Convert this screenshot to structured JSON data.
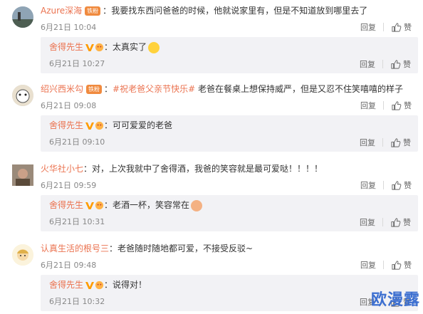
{
  "comments": [
    {
      "username": "Azure深海",
      "badge": "铁粉",
      "text": "我要找东西问爸爸的时候，他就说家里有，但是不知道放到哪里去了",
      "time": "6月21日 10:04",
      "reply_label": "回复",
      "like_label": "赞",
      "reply": {
        "username": "舍得先生",
        "text": "太真实了",
        "time": "6月21日 10:27",
        "reply_label": "回复",
        "like_label": "赞",
        "emoji": "laughing-tears-emoji"
      }
    },
    {
      "username": "绍兴西米勾",
      "badge": "铁粉",
      "text": "#祝老爸父亲节快乐# 老爸在餐桌上想保持威严，但是又忍不住笑嘻嘻的样子",
      "topic": "#祝老爸父亲节快乐#",
      "text_after_topic": " 老爸在餐桌上想保持威严，但是又忍不住笑嘻嘻的样子",
      "time": "6月21日 09:08",
      "reply_label": "回复",
      "like_label": "赞",
      "reply": {
        "username": "舍得先生",
        "text": "可可爱爱的老爸",
        "time": "6月21日 09:10",
        "reply_label": "回复",
        "like_label": "赞"
      }
    },
    {
      "username": "火华社小七",
      "text": "对，上次我就中了舍得酒，我爸的笑容就是最可爱哒！！！！",
      "time": "6月21日 09:59",
      "reply_label": "回复",
      "like_label": "赞",
      "reply": {
        "username": "舍得先生",
        "text": "老酒一杯，笑容常在",
        "time": "6月21日 10:31",
        "reply_label": "回复",
        "like_label": "赞",
        "emoji": "smiling-face-emoji"
      }
    },
    {
      "username": "认真生活的根号三",
      "text": "老爸随时随地都可爱，不接受反驳~",
      "time": "6月21日 09:48",
      "reply_label": "回复",
      "like_label": "赞",
      "reply": {
        "username": "舍得先生",
        "text": "说得对！",
        "time": "6月21日 10:32",
        "reply_label": "回复",
        "like_label": "赞"
      }
    }
  ],
  "watermark": "欧漫露",
  "colors": {
    "username": "#eb7350",
    "topic": "#eb7350",
    "time": "#888888",
    "reply_bg": "#f2f2f5",
    "badge": "#f08a3e",
    "watermark": "#3c6fd0"
  }
}
